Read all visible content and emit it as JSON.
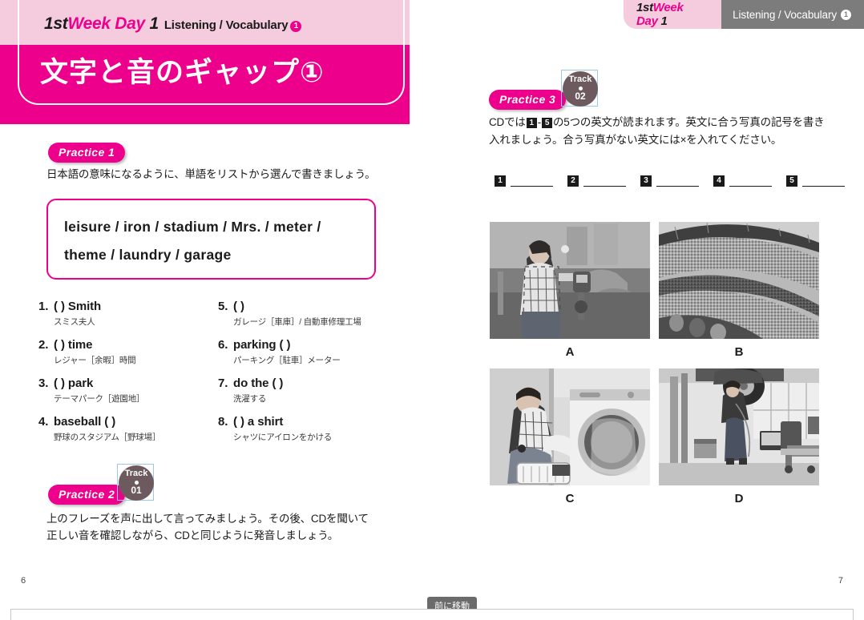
{
  "viewer": {
    "tooltip_label": "前に移動",
    "page_number_left": "6",
    "page_number_right": "7"
  },
  "colors": {
    "accent_magenta": "#ec008c",
    "header_light_pink": "#f5ccdd",
    "header_gray": "#7c7c7c",
    "track_badge": "#6d5a5e",
    "selection_border": "#9dc6e8"
  },
  "left_page": {
    "header": {
      "kicker_week": "1st",
      "kicker_week_rest": "Week Day",
      "kicker_day_num": "1",
      "kicker_sub": "Listening / Vocabulary",
      "kicker_circle": "1",
      "title": "文字と音のギャップ①"
    },
    "practice1": {
      "badge": "Practice 1",
      "instruction": "日本語の意味になるように、単語をリストから選んで書きましょう。",
      "wordbox": [
        "leisure  /  iron  /  stadium  /  Mrs.  /  meter  /",
        "theme  /  laundry  /  garage"
      ],
      "items": [
        {
          "num": "1.",
          "main": "(                    )  Smith",
          "gloss": "スミス夫人"
        },
        {
          "num": "2.",
          "main": "(                     )  time",
          "gloss": "レジャー［余暇］時間"
        },
        {
          "num": "3.",
          "main": "(                     )  park",
          "gloss": "テーマパーク［遊園地］"
        },
        {
          "num": "4.",
          "main": "baseball  (                 )",
          "gloss": "野球のスタジアム［野球場］"
        },
        {
          "num": "5.",
          "main": "(                   )",
          "gloss": "ガレージ［車庫］/ 自動車修理工場"
        },
        {
          "num": "6.",
          "main": "parking  (                      )",
          "gloss": "パーキング［駐車］メーター"
        },
        {
          "num": "7.",
          "main": "do the  (                   )",
          "gloss": "洗濯する"
        },
        {
          "num": "8.",
          "main": "(                 )  a shirt",
          "gloss": "シャツにアイロンをかける"
        }
      ]
    },
    "practice2": {
      "badge": "Practice 2",
      "track_label": "Track",
      "track_number": "01",
      "instruction_line1": "上のフレーズを声に出して言ってみましょう。その後、CDを聞いて",
      "instruction_line2": "正しい音を確認しながら、CDと同じように発音しましょう。"
    }
  },
  "right_page": {
    "header": {
      "kicker_week": "1st",
      "kicker_week_rest": "Week Day",
      "kicker_day_num": "1",
      "kicker_sub": "Listening / Vocabulary",
      "kicker_circle": "1"
    },
    "practice3": {
      "badge": "Practice 3",
      "track_label": "Track",
      "track_number": "02",
      "instr_a": "CDでは",
      "instr_n1": "1",
      "instr_dash": "-",
      "instr_n5": "5",
      "instr_b": "の5つの英文が読まれます。英文に合う写真の記号を書き入れましょう。合う写真がない英文には×を入れてください。",
      "answers": [
        "1",
        "2",
        "3",
        "4",
        "5"
      ],
      "photos": [
        {
          "label": "A",
          "alt": "woman-at-parking-meter"
        },
        {
          "label": "B",
          "alt": "stadium-crowd"
        },
        {
          "label": "C",
          "alt": "man-doing-laundry"
        },
        {
          "label": "D",
          "alt": "auto-repair-garage"
        }
      ]
    }
  }
}
